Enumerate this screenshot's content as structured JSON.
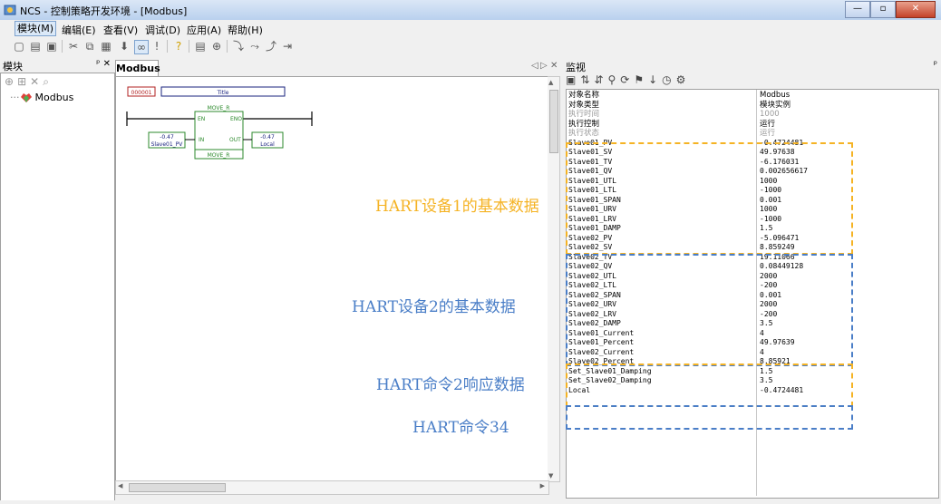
{
  "window": {
    "title": "NCS - 控制策略开发环境 - [Modbus]"
  },
  "menu": [
    "模块(M)",
    "编辑(E)",
    "查看(V)",
    "调试(D)",
    "应用(A)",
    "帮助(H)"
  ],
  "left_panel": {
    "title": "模块",
    "pin": "ᅟ× ",
    "tree_item": "Modbus"
  },
  "editor": {
    "tab": "Modbus",
    "block": {
      "id": "000001",
      "title": "Title",
      "func": "MOVE_R",
      "en": "EN",
      "eno": "ENO",
      "in": "IN",
      "out": "OUT",
      "footer": "MOVE_R",
      "in_value": "-0.47",
      "in_tag": "Slave01_PV",
      "out_value": "-0.47",
      "out_tag": "Local"
    }
  },
  "monitor": {
    "title": "监视",
    "rows": [
      {
        "name": "对象名称",
        "value": "Modbus",
        "grey": false,
        "cjk": true
      },
      {
        "name": "对象类型",
        "value": "模块实例",
        "grey": false,
        "cjk": true
      },
      {
        "name": "执行时间",
        "value": "1000",
        "grey": true,
        "cjk": true
      },
      {
        "name": "执行控制",
        "value": "运行",
        "grey": false,
        "cjk": true
      },
      {
        "name": "执行状态",
        "value": "运行",
        "grey": true,
        "cjk": true
      },
      {
        "name": "Slave01_PV",
        "value": "-0.4724481"
      },
      {
        "name": "Slave01_SV",
        "value": "49.97638"
      },
      {
        "name": "Slave01_TV",
        "value": "-6.176031"
      },
      {
        "name": "Slave01_QV",
        "value": "0.002656617"
      },
      {
        "name": "Slave01_UTL",
        "value": "1000"
      },
      {
        "name": "Slave01_LTL",
        "value": "-1000"
      },
      {
        "name": "Slave01_SPAN",
        "value": "0.001"
      },
      {
        "name": "Slave01_URV",
        "value": "1000"
      },
      {
        "name": "Slave01_LRV",
        "value": "-1000"
      },
      {
        "name": "Slave01_DAMP",
        "value": "1.5"
      },
      {
        "name": "Slave02_PV",
        "value": "-5.096471"
      },
      {
        "name": "Slave02_SV",
        "value": "8.859249"
      },
      {
        "name": "Slave02_TV",
        "value": "19.11066"
      },
      {
        "name": "Slave02_QV",
        "value": "0.08449128"
      },
      {
        "name": "Slave02_UTL",
        "value": "2000"
      },
      {
        "name": "Slave02_LTL",
        "value": "-200"
      },
      {
        "name": "Slave02_SPAN",
        "value": "0.001"
      },
      {
        "name": "Slave02_URV",
        "value": "2000"
      },
      {
        "name": "Slave02_LRV",
        "value": "-200"
      },
      {
        "name": "Slave02_DAMP",
        "value": "3.5"
      },
      {
        "name": "Slave01_Current",
        "value": "4"
      },
      {
        "name": "Slave01_Percent",
        "value": "49.97639"
      },
      {
        "name": "Slave02_Current",
        "value": "4"
      },
      {
        "name": "Slave02_Percent",
        "value": "8.85921"
      },
      {
        "name": "Set_Slave01_Damping",
        "value": "1.5"
      },
      {
        "name": "Set_Slave02_Damping",
        "value": "3.5"
      },
      {
        "name": "Local",
        "value": "-0.4724481"
      }
    ]
  },
  "annotations": {
    "hart1": "HART设备1的基本数据",
    "hart2": "HART设备2的基本数据",
    "cmd2": "HART命令2响应数据",
    "cmd34": "HART命令34"
  },
  "colors": {
    "orange": "#f5b324",
    "blue": "#4a7ec7",
    "green": "#2c8a2c",
    "navy": "#1a237e",
    "red": "#b22222"
  }
}
